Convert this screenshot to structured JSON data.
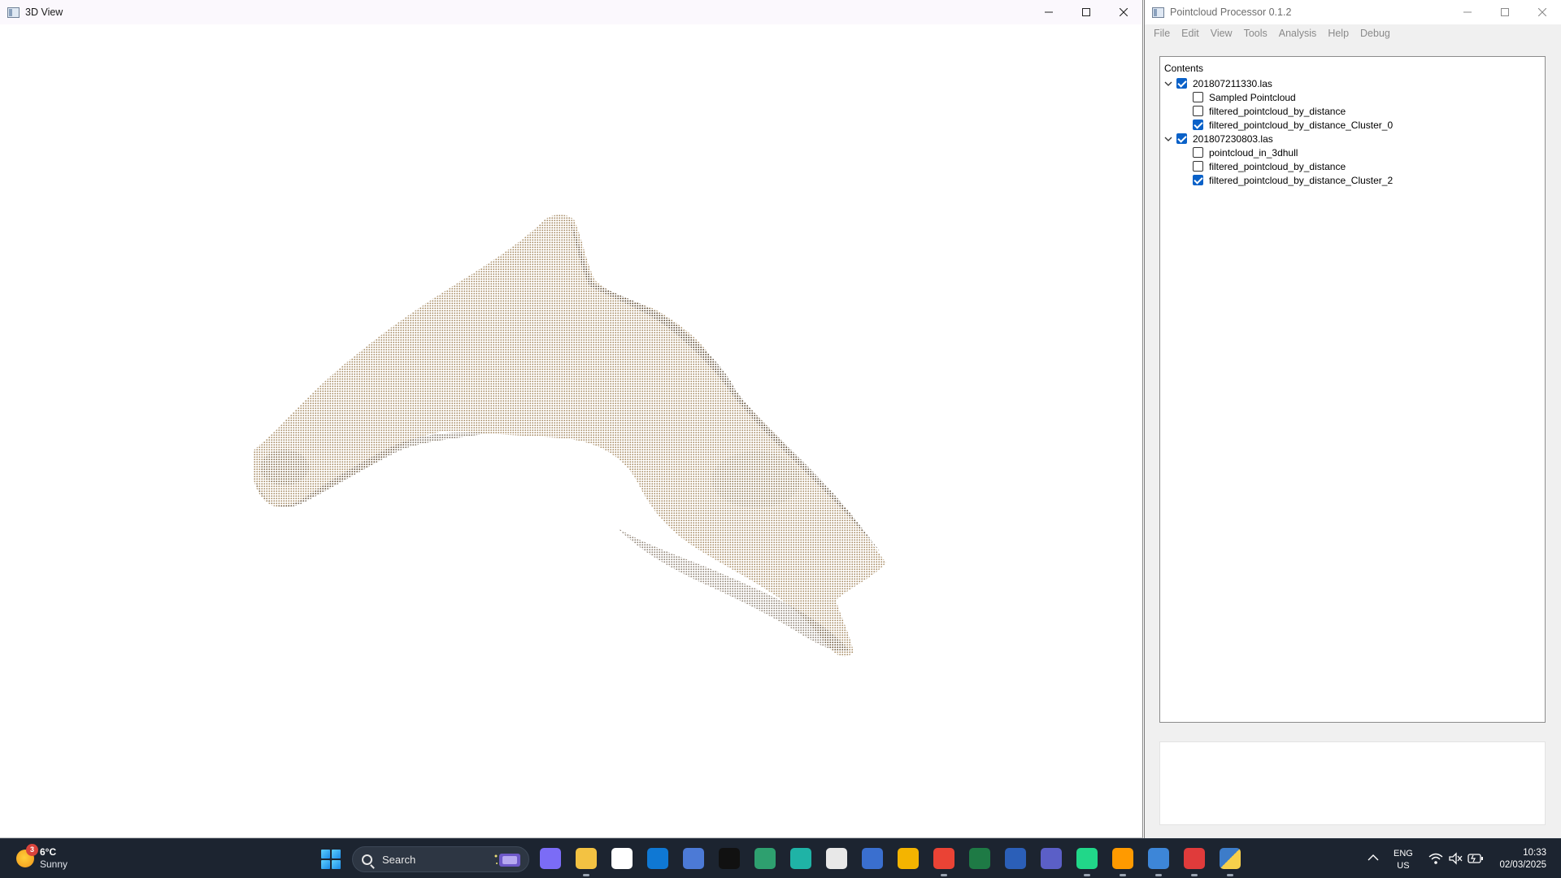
{
  "view3d": {
    "title": "3D View",
    "icon": "app-window-icon"
  },
  "processor": {
    "title": "Pointcloud Processor 0.1.2",
    "icon": "app-window-icon",
    "menu": [
      "File",
      "Edit",
      "View",
      "Tools",
      "Analysis",
      "Help",
      "Debug"
    ],
    "contents_header": "Contents",
    "tree": [
      {
        "label": "201807211330.las",
        "checked": true,
        "expanded": true,
        "children": [
          {
            "label": "Sampled Pointcloud",
            "checked": false
          },
          {
            "label": "filtered_pointcloud_by_distance",
            "checked": false
          },
          {
            "label": "filtered_pointcloud_by_distance_Cluster_0",
            "checked": true
          }
        ]
      },
      {
        "label": "201807230803.las",
        "checked": true,
        "expanded": true,
        "children": [
          {
            "label": "pointcloud_in_3dhull",
            "checked": false
          },
          {
            "label": "filtered_pointcloud_by_distance",
            "checked": false
          },
          {
            "label": "filtered_pointcloud_by_distance_Cluster_2",
            "checked": true
          }
        ]
      }
    ]
  },
  "taskbar": {
    "weather": {
      "temp": "6°C",
      "condition": "Sunny",
      "badge": "3"
    },
    "search_placeholder": "Search",
    "apps": [
      {
        "name": "copilot-icon",
        "color": "#7b6cf6",
        "active": false
      },
      {
        "name": "file-explorer-icon",
        "color": "#f3c242",
        "active": true
      },
      {
        "name": "microsoft-store-icon",
        "color": "#ffffff",
        "active": false
      },
      {
        "name": "outlook-icon",
        "color": "#0f78d4",
        "active": false
      },
      {
        "name": "virtualbox-icon",
        "color": "#4c7ad6",
        "active": false
      },
      {
        "name": "terminal-icon",
        "color": "#111111",
        "active": false
      },
      {
        "name": "chatgpt-icon",
        "color": "#2ea06f",
        "active": false
      },
      {
        "name": "edge-icon",
        "color": "#1fb3a6",
        "active": false
      },
      {
        "name": "sketch-app-icon",
        "color": "#e8e8e8",
        "active": false
      },
      {
        "name": "remote-desktop-icon",
        "color": "#3a6fcf",
        "active": false
      },
      {
        "name": "brave-icon",
        "color": "#f4b400",
        "active": false
      },
      {
        "name": "chrome-icon",
        "color": "#ea4335",
        "active": true
      },
      {
        "name": "excel-icon",
        "color": "#1e7a45",
        "active": false
      },
      {
        "name": "word-icon",
        "color": "#2b5fb8",
        "active": false
      },
      {
        "name": "teams-icon",
        "color": "#5b5fc7",
        "active": false
      },
      {
        "name": "pycharm-icon",
        "color": "#21d789",
        "active": true
      },
      {
        "name": "illustrator-icon",
        "color": "#ff9a00",
        "active": true
      },
      {
        "name": "inkscape-icon",
        "color": "#3d86d8",
        "active": true
      },
      {
        "name": "snipping-tool-icon",
        "color": "#e03b3b",
        "active": true
      },
      {
        "name": "python-icon",
        "color": "#3d7cc9",
        "active": true
      }
    ],
    "language": [
      "ENG",
      "US"
    ],
    "time": "10:33",
    "date": "02/03/2025"
  }
}
